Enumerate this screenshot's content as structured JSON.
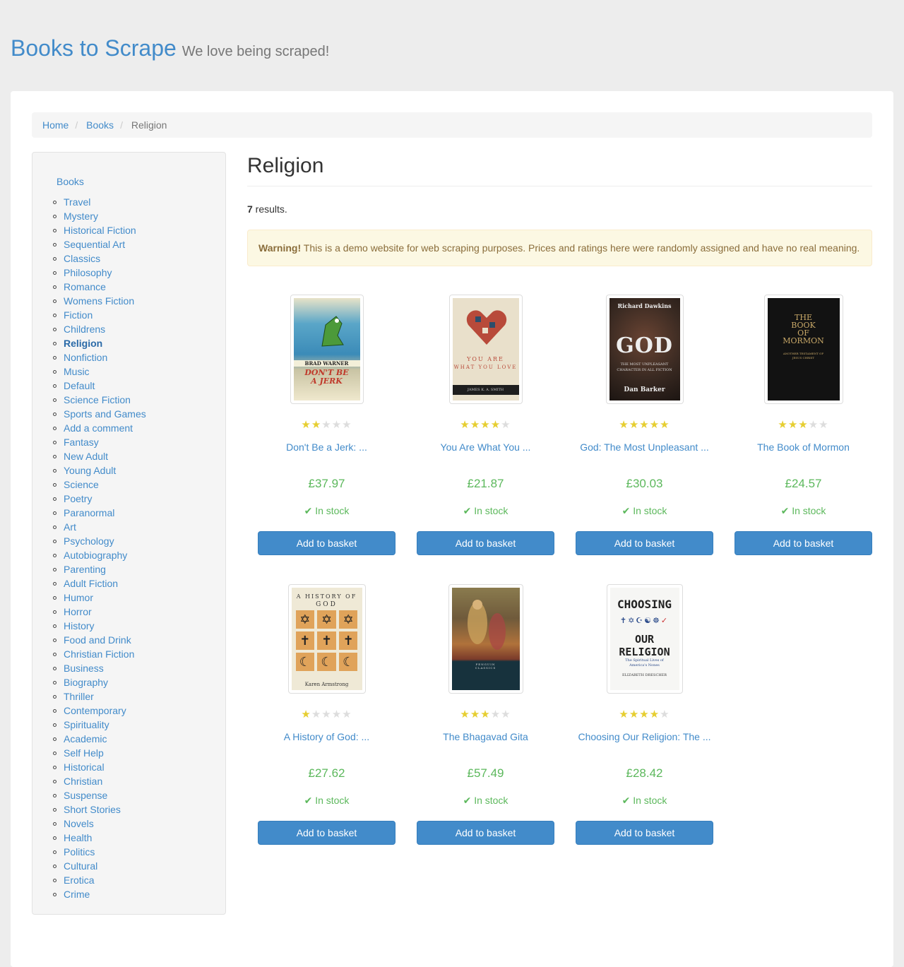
{
  "header": {
    "brand": "Books to Scrape",
    "tagline": "We love being scraped!"
  },
  "breadcrumb": {
    "home": "Home",
    "books": "Books",
    "current": "Religion"
  },
  "sidebar": {
    "root": "Books",
    "categories": [
      "Travel",
      "Mystery",
      "Historical Fiction",
      "Sequential Art",
      "Classics",
      "Philosophy",
      "Romance",
      "Womens Fiction",
      "Fiction",
      "Childrens",
      "Religion",
      "Nonfiction",
      "Music",
      "Default",
      "Science Fiction",
      "Sports and Games",
      "Add a comment",
      "Fantasy",
      "New Adult",
      "Young Adult",
      "Science",
      "Poetry",
      "Paranormal",
      "Art",
      "Psychology",
      "Autobiography",
      "Parenting",
      "Adult Fiction",
      "Humor",
      "Horror",
      "History",
      "Food and Drink",
      "Christian Fiction",
      "Business",
      "Biography",
      "Thriller",
      "Contemporary",
      "Spirituality",
      "Academic",
      "Self Help",
      "Historical",
      "Christian",
      "Suspense",
      "Short Stories",
      "Novels",
      "Health",
      "Politics",
      "Cultural",
      "Erotica",
      "Crime"
    ],
    "current": "Religion"
  },
  "main": {
    "title": "Religion",
    "results_count": "7",
    "results_suffix": " results.",
    "warning_label": "Warning!",
    "warning_text": " This is a demo website for web scraping purposes. Prices and ratings here were randomly assigned and have no real meaning."
  },
  "products": [
    {
      "title": "Don't Be a Jerk: ...",
      "price": "£37.97",
      "rating": 2,
      "stock": "In stock",
      "button": "Add to basket",
      "cover_text": [
        "BRAD WARNER",
        "DON'T BE A JERK"
      ]
    },
    {
      "title": "You Are What You ...",
      "price": "£21.87",
      "rating": 4,
      "stock": "In stock",
      "button": "Add to basket",
      "cover_text": [
        "YOU ARE",
        "WHAT YOU LOVE",
        "JAMES K. A. SMITH"
      ]
    },
    {
      "title": "God: The Most Unpleasant ...",
      "price": "£30.03",
      "rating": 5,
      "stock": "In stock",
      "button": "Add to basket",
      "cover_text": [
        "Richard Dawkins",
        "GOD",
        "THE MOST UNPLEASANT CHARACTER IN ALL FICTION",
        "Dan Barker"
      ]
    },
    {
      "title": "The Book of Mormon",
      "price": "£24.57",
      "rating": 3,
      "stock": "In stock",
      "button": "Add to basket",
      "cover_text": [
        "THE",
        "BOOK",
        "OF",
        "MORMON",
        "ANOTHER TESTAMENT OF JESUS CHRIST"
      ]
    },
    {
      "title": "A History of God: ...",
      "price": "£27.62",
      "rating": 1,
      "stock": "In stock",
      "button": "Add to basket",
      "cover_text": [
        "A HISTORY OF",
        "GOD",
        "Karen Armstrong"
      ]
    },
    {
      "title": "The Bhagavad Gita",
      "price": "£57.49",
      "rating": 3,
      "stock": "In stock",
      "button": "Add to basket",
      "cover_text": [
        "PENGUIN",
        "CLASSICS"
      ]
    },
    {
      "title": "Choosing Our Religion: The ...",
      "price": "£28.42",
      "rating": 4,
      "stock": "In stock",
      "button": "Add to basket",
      "cover_text": [
        "CHOOSING",
        "OUR RELIGION",
        "The Spiritual Lives of America's Nones",
        "ELIZABETH DRESCHER"
      ]
    }
  ],
  "colors": {
    "link": "#428bca",
    "price": "#5cb85c",
    "star_on": "#e6ce31",
    "star_off": "#dddddd",
    "button": "#428bca",
    "warning_bg": "#fcf8e3"
  },
  "icons": {
    "star": "star-icon",
    "in_stock": "check-icon"
  }
}
